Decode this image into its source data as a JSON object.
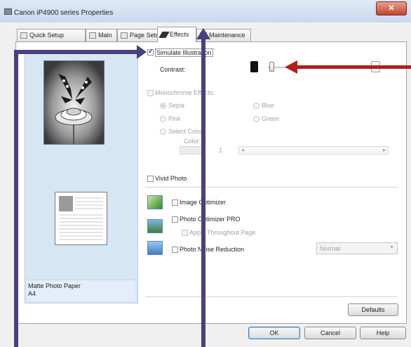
{
  "window": {
    "title": "Canon iP4900 series Properties",
    "close_glyph": "✕"
  },
  "tabs": [
    {
      "label": "Quick Setup"
    },
    {
      "label": "Main"
    },
    {
      "label": "Page Setup"
    },
    {
      "label": "Effects",
      "active": true
    },
    {
      "label": "Maintenance"
    }
  ],
  "preview": {
    "paper_name": "Matte Photo Paper",
    "paper_size": "A4"
  },
  "simulate_illustration": {
    "label": "Simulate Illustration",
    "checked": true
  },
  "contrast": {
    "label": "Contrast:",
    "level": 0.0
  },
  "monochrome": {
    "label": "Monochrome Effects:",
    "checked": false,
    "options": [
      {
        "label": "Sepia",
        "selected": true
      },
      {
        "label": "Blue",
        "selected": false
      },
      {
        "label": "Pink",
        "selected": false
      },
      {
        "label": "Green",
        "selected": false
      },
      {
        "label": "Select Color",
        "selected": false
      }
    ],
    "color_label": "Color:",
    "color_value": "1"
  },
  "vivid_photo": {
    "label": "Vivid Photo",
    "checked": false
  },
  "image_optimizer": {
    "label": "Image Optimizer",
    "checked": false
  },
  "photo_optimizer_pro": {
    "label": "Photo Optimizer PRO",
    "checked": false
  },
  "apply_throughout": {
    "label": "Apply Throughout Page",
    "checked": false
  },
  "photo_noise": {
    "label": "Photo Noise Reduction",
    "checked": false,
    "select_value": "Normal"
  },
  "buttons": {
    "defaults": "Defaults",
    "ok": "OK",
    "cancel": "Cancel",
    "help": "Help"
  },
  "colors": {
    "arrow_vertical": "#4b3f7c",
    "arrow_blue": "#3f5e9e",
    "arrow_red": "#b21d1d"
  }
}
